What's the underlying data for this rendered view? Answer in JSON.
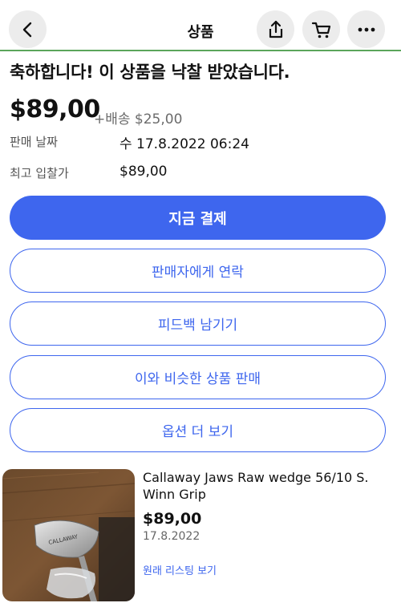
{
  "header": {
    "title": "상품",
    "back_icon": "chevron-left-icon",
    "share_icon": "share-icon",
    "cart_icon": "cart-icon",
    "more_icon": "more-icon"
  },
  "headline": "축하합니다! 이 상품을 낙찰 받았습니다.",
  "price": "$89,00",
  "shipping": "+배송 $25,00",
  "details": [
    {
      "label": "판매 날짜",
      "value": "수 17.8.2022 06:24"
    },
    {
      "label": "최고 입찰가",
      "value": "$89,00"
    }
  ],
  "actions": {
    "pay_now": "지금 결제",
    "contact_seller": "판매자에게 연락",
    "leave_feedback": "피드백 남기기",
    "sell_similar": "이와 비슷한 상품 판매",
    "more_options": "옵션 더 보기"
  },
  "item": {
    "title": "Callaway Jaws Raw wedge 56/10 S. Winn Grip",
    "price": "$89,00",
    "date": "17.8.2022",
    "link": "원래 리스팅 보기"
  },
  "colors": {
    "accent": "#3e66ee",
    "header_rule": "#5ba55b"
  }
}
